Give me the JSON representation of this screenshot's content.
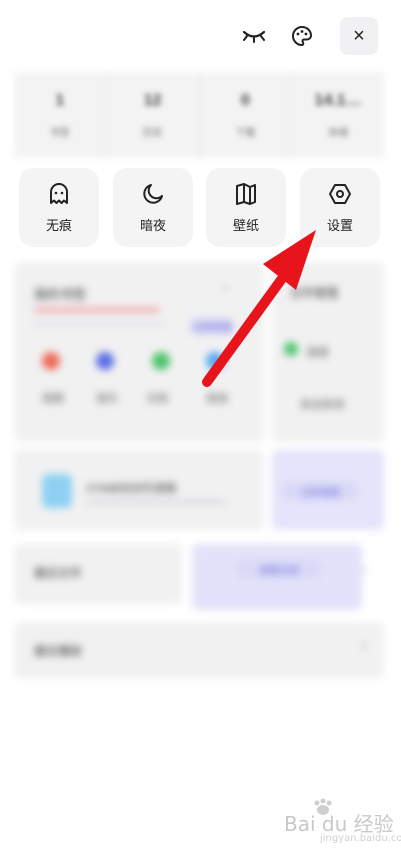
{
  "top_bar": {
    "eye_icon": "eye-closed-icon",
    "palette_icon": "palette-icon",
    "close_label": "×"
  },
  "stats": [
    {
      "value": "1",
      "label": "书签"
    },
    {
      "value": "12",
      "label": "历史"
    },
    {
      "value": "0",
      "label": "下载"
    },
    {
      "value": "14.1…",
      "label": "存储"
    }
  ],
  "quick_actions": [
    {
      "label": "无痕",
      "icon": "ghost-icon"
    },
    {
      "label": "暗夜",
      "icon": "moon-icon"
    },
    {
      "label": "壁纸",
      "icon": "book-open-icon"
    },
    {
      "label": "设置",
      "icon": "hexagon-settings-icon"
    }
  ],
  "blurred": {
    "card_title": "我的书签",
    "tag": "立即查看",
    "side_title": "文件管理",
    "app_labels": [
      "视频",
      "音乐",
      "文档",
      "其他"
    ],
    "side_labels": [
      "清理",
      "安全检测"
    ],
    "promo_text": "370MB空间可清理",
    "promo_button": "立即清理",
    "row1_label": "最近文件",
    "row1_button": "查看全部",
    "row2_label": "最近播放"
  },
  "watermark": {
    "text": "Bai du 经验",
    "sub": "jingyan.baidu.com"
  },
  "colors": {
    "arrow": "#e8141c",
    "tile_bg": "#f4f4f5"
  }
}
